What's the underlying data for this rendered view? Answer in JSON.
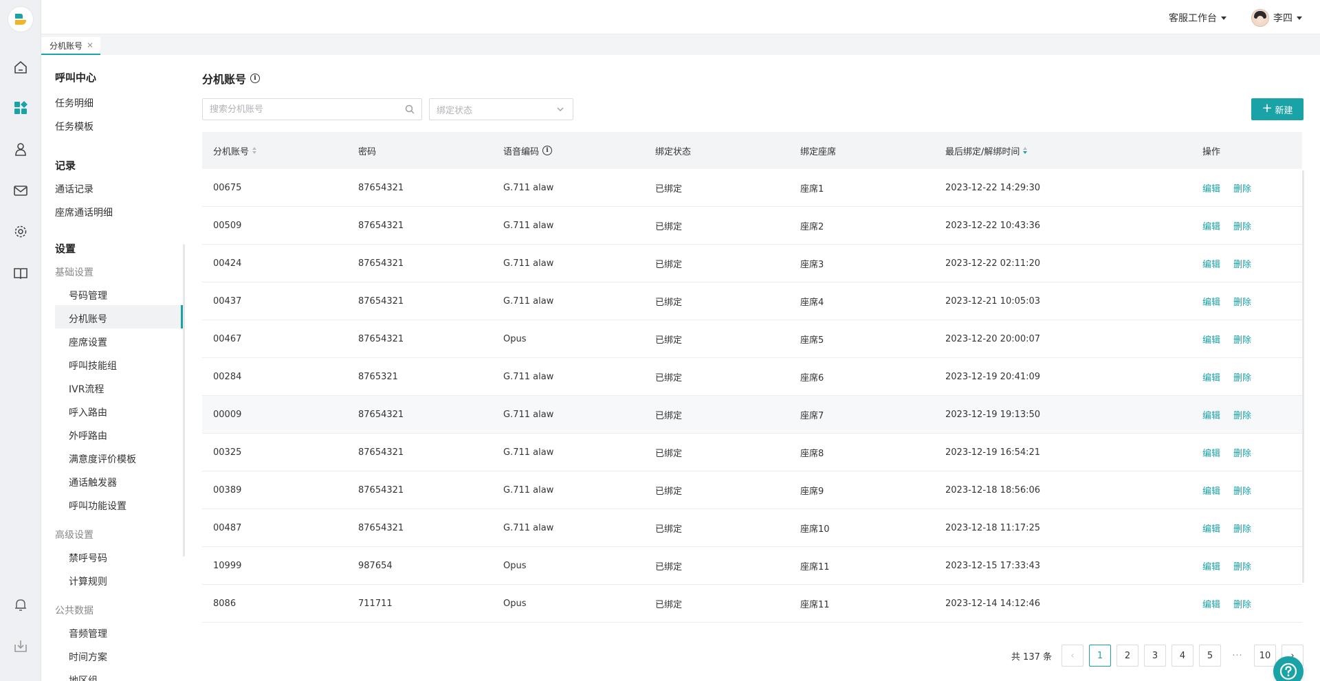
{
  "header": {
    "workspace_label": "客服工作台",
    "user_name": "李四"
  },
  "tabs": [
    {
      "label": "分机账号"
    }
  ],
  "sidebar": {
    "section_call": "呼叫中心",
    "call_items": [
      "任务明细",
      "任务模板"
    ],
    "section_records": "记录",
    "record_items": [
      "通话记录",
      "座席通话明细"
    ],
    "section_settings": "设置",
    "basic_title": "基础设置",
    "basic_items": [
      "号码管理",
      "分机账号",
      "座席设置",
      "呼叫技能组",
      "IVR流程",
      "呼入路由",
      "外呼路由",
      "满意度评价模板",
      "通话触发器",
      "呼叫功能设置"
    ],
    "advanced_title": "高级设置",
    "advanced_items": [
      "禁呼号码",
      "计算规则"
    ],
    "public_title": "公共数据",
    "public_items": [
      "音频管理",
      "时间方案",
      "地区组"
    ]
  },
  "page": {
    "title": "分机账号",
    "search_placeholder": "搜索分机账号",
    "status_placeholder": "绑定状态",
    "new_button": "新建"
  },
  "table": {
    "headers": [
      "分机账号",
      "密码",
      "语音编码",
      "绑定状态",
      "绑定座席",
      "最后绑定/解绑时间",
      "操作"
    ],
    "edit_label": "编辑",
    "delete_label": "删除",
    "rows": [
      [
        "00675",
        "87654321",
        "G.711 alaw",
        "已绑定",
        "座席1",
        "2023-12-22 14:29:30"
      ],
      [
        "00509",
        "87654321",
        "G.711 alaw",
        "已绑定",
        "座席2",
        "2023-12-22 10:43:36"
      ],
      [
        "00424",
        "87654321",
        "G.711 alaw",
        "已绑定",
        "座席3",
        "2023-12-22 02:11:20"
      ],
      [
        "00437",
        "87654321",
        "G.711 alaw",
        "已绑定",
        "座席4",
        "2023-12-21 10:05:03"
      ],
      [
        "00467",
        "87654321",
        "Opus",
        "已绑定",
        "座席5",
        "2023-12-20 20:00:07"
      ],
      [
        "00284",
        "8765321",
        "G.711 alaw",
        "已绑定",
        "座席6",
        "2023-12-19 20:41:09"
      ],
      [
        "00009",
        "87654321",
        "G.711 alaw",
        "已绑定",
        "座席7",
        "2023-12-19 19:13:50"
      ],
      [
        "00325",
        "87654321",
        "G.711 alaw",
        "已绑定",
        "座席8",
        "2023-12-19 16:54:21"
      ],
      [
        "00389",
        "87654321",
        "G.711 alaw",
        "已绑定",
        "座席9",
        "2023-12-18 18:56:06"
      ],
      [
        "00487",
        "87654321",
        "G.711 alaw",
        "已绑定",
        "座席10",
        "2023-12-18 11:17:25"
      ],
      [
        "10999",
        "987654",
        "Opus",
        "已绑定",
        "座席11",
        "2023-12-15 17:33:43"
      ],
      [
        "8086",
        "711711",
        "Opus",
        "已绑定",
        "座席11",
        "2023-12-14 14:12:46"
      ]
    ]
  },
  "pagination": {
    "total_text": "共 137 条",
    "pages": [
      "1",
      "2",
      "3",
      "4",
      "5"
    ],
    "last_page": "10",
    "current": "1",
    "ellipsis": "···",
    "prev": "‹",
    "next": "›"
  },
  "colors": {
    "accent": "#1aa3a7",
    "rail_bg": "#eef0f3"
  },
  "icons": [
    "logo-icon",
    "home-icon",
    "dashboard-icon",
    "contacts-icon",
    "mail-icon",
    "gear-icon",
    "book-icon",
    "bell-icon",
    "download-icon",
    "info-icon",
    "search-icon",
    "chevron-down-icon",
    "help-icon"
  ]
}
